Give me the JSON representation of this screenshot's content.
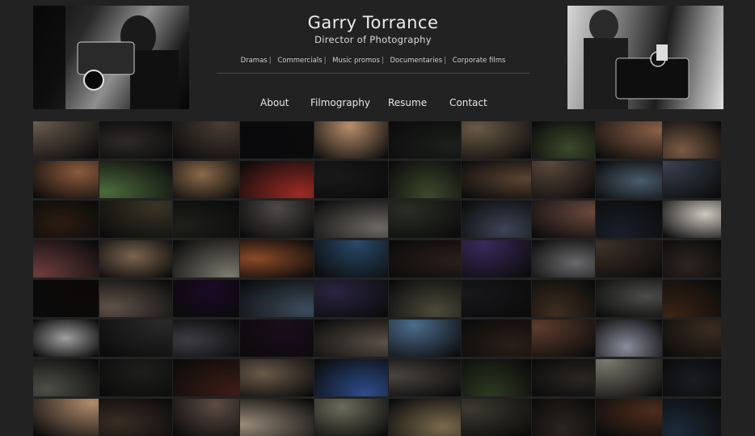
{
  "header": {
    "title": "Garry Torrance",
    "subtitle": "Director of Photography"
  },
  "genres": [
    {
      "label": "Dramas",
      "sep": "|"
    },
    {
      "label": "Commercials",
      "sep": "|"
    },
    {
      "label": "Music promos",
      "sep": "|"
    },
    {
      "label": "Documentaries",
      "sep": "|"
    },
    {
      "label": "Corporate films",
      "sep": ""
    }
  ],
  "nav": [
    {
      "label": "About"
    },
    {
      "label": "Filmography"
    },
    {
      "label": "Resume"
    },
    {
      "label": "Contact"
    }
  ],
  "colors": {
    "background": "#222222",
    "text": "#ececec"
  },
  "thumbnails": [
    "#6b5e4e",
    "#2e2a28",
    "#4a3d33",
    "#0a0a0c",
    "#b98f6c",
    "#1c1f1c",
    "#6a5a46",
    "#3a4a2a",
    "#8a6048",
    "#7a5b44",
    "#8c5a3c",
    "#4c6a3c",
    "#8a6a4a",
    "#9c2a24",
    "#1a1a1c",
    "#3c4a2c",
    "#5a4432",
    "#5c4a3e",
    "#4a5c6c",
    "#3a4250",
    "#2c1c10",
    "#3a3426",
    "#1e1e1a",
    "#4e4a48",
    "#6c6862",
    "#2a2e24",
    "#3c4456",
    "#6a4a3e",
    "#1a1e2a",
    "#cfc8c0",
    "#6c3c3c",
    "#7a6450",
    "#7c7a70",
    "#8a4a28",
    "#2a4a6a",
    "#2a1e1a",
    "#3a2a5a",
    "#6a6a6c",
    "#3c3028",
    "#2e2420",
    "#0c0806",
    "#5e5248",
    "#1a0a24",
    "#3c4c5c",
    "#2a2440",
    "#4c4a3a",
    "#18181c",
    "#3e2e20",
    "#4c4c4a",
    "#3a2414",
    "#a0a0a2",
    "#2a2a2a",
    "#3c3c44",
    "#1c0c1c",
    "#5a5048",
    "#4c6c8c",
    "#2a1e18",
    "#5c3c2c",
    "#8a8c9c",
    "#3a2c20",
    "#4e4e48",
    "#1e1e1c",
    "#3c1c16",
    "#6a5a48",
    "#2c4c8a",
    "#4a4440",
    "#2e3a20",
    "#2a2622",
    "#7c7a6e",
    "#1a1c24",
    "#b08c6c",
    "#3a2c24",
    "#5c4c44",
    "#9a8c7a",
    "#6c6c5c",
    "#7a6a4c",
    "#3c3a30",
    "#2c2420",
    "#4c2c1c",
    "#1c2a3a"
  ]
}
